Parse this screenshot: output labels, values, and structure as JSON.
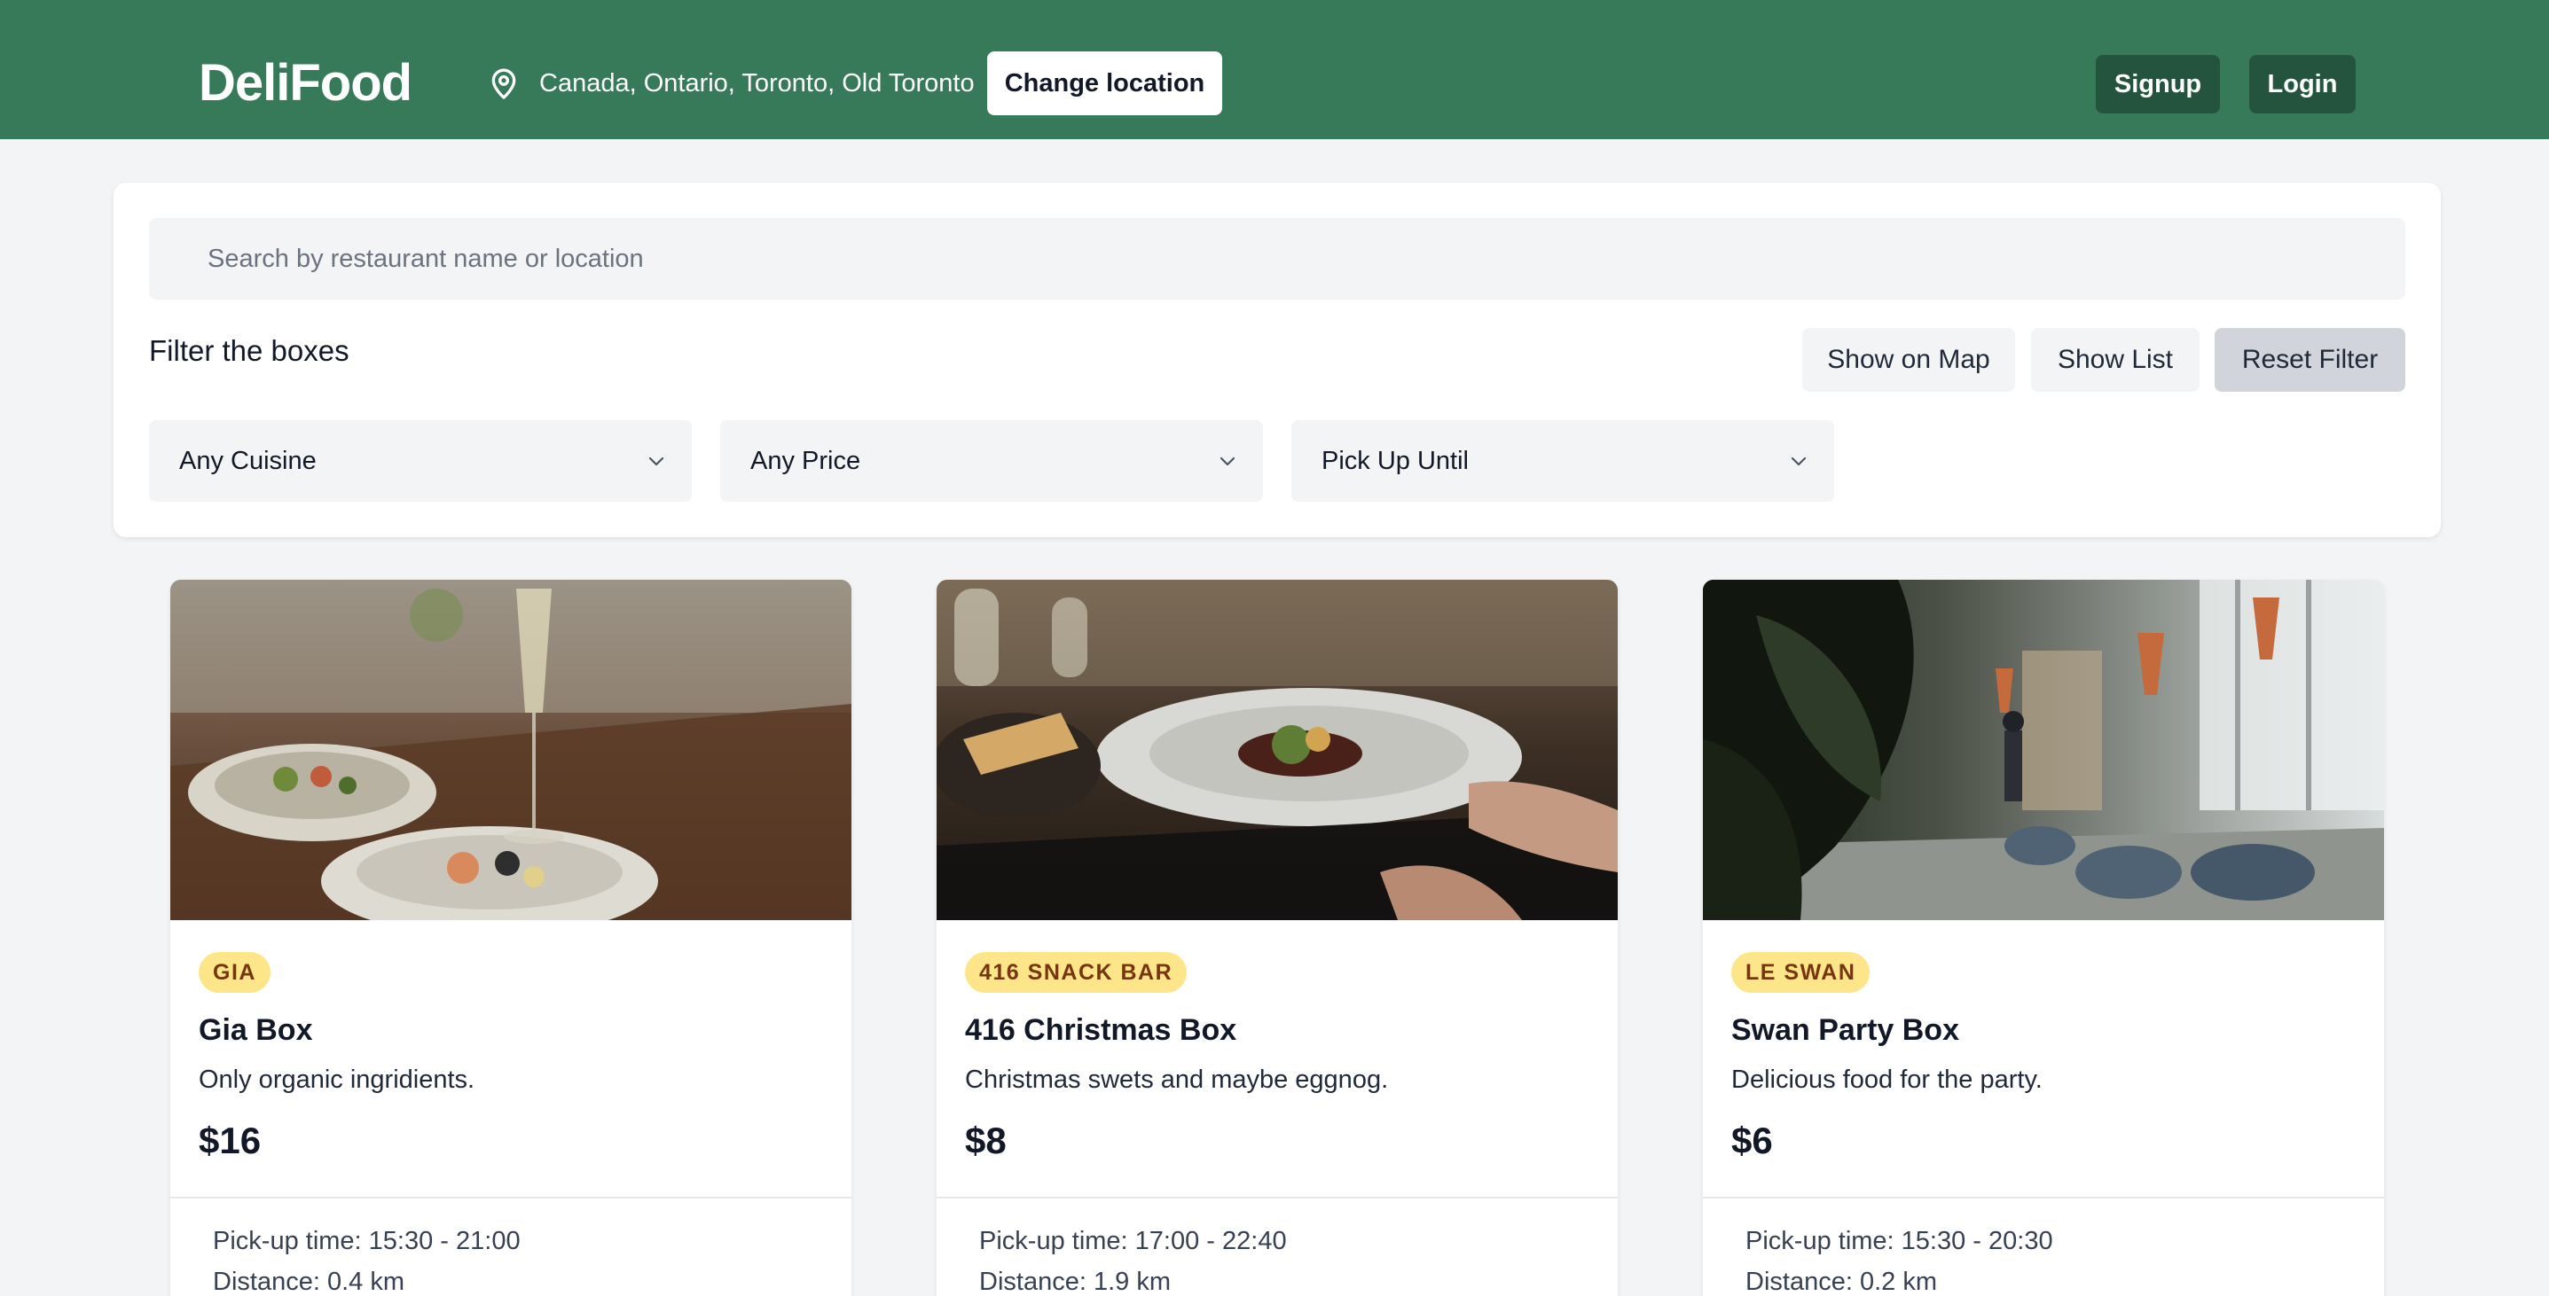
{
  "header": {
    "logo": "DeliFood",
    "location_icon": "map-pin-icon",
    "location": "Canada, Ontario, Toronto, Old Toronto",
    "change_location": "Change location",
    "signup": "Signup",
    "login": "Login",
    "brand_color": "#367a5a"
  },
  "search": {
    "placeholder": "Search by restaurant name or location",
    "value": ""
  },
  "filters": {
    "title": "Filter the boxes",
    "show_on_map": "Show on Map",
    "show_list": "Show List",
    "reset": "Reset Filter",
    "selects": [
      {
        "value": "Any Cuisine",
        "icon": "chevron-down-icon"
      },
      {
        "value": "Any Price",
        "icon": "chevron-down-icon"
      },
      {
        "value": "Pick Up Until",
        "icon": "chevron-down-icon"
      }
    ]
  },
  "boxes": [
    {
      "restaurant": "GIA",
      "title": "Gia Box",
      "description": "Only organic ingridients.",
      "price": "$16",
      "pickup": "Pick-up time: 15:30 - 21:00",
      "distance": "Distance: 0.4 km"
    },
    {
      "restaurant": "416 SNACK BAR",
      "title": "416 Christmas Box",
      "description": "Christmas swets and maybe eggnog.",
      "price": "$8",
      "pickup": "Pick-up time: 17:00 - 22:40",
      "distance": "Distance: 1.9 km"
    },
    {
      "restaurant": "LE SWAN",
      "title": "Swan Party Box",
      "description": "Delicious food for the party.",
      "price": "$6",
      "pickup": "Pick-up time: 15:30 - 20:30",
      "distance": "Distance: 0.2 km"
    }
  ]
}
